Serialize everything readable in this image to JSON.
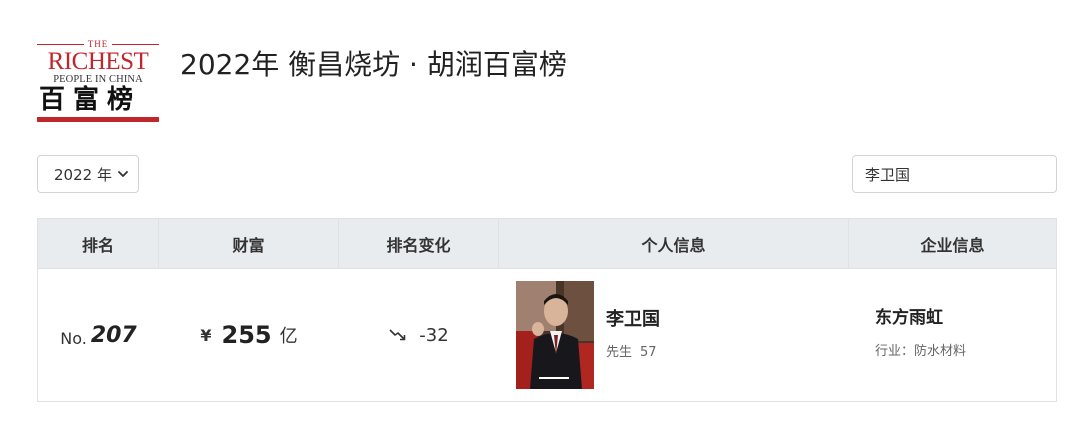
{
  "logo": {
    "the": "THE",
    "richest": "RICHEST",
    "people": "PEOPLE IN CHINA",
    "cn": "百富榜",
    "brand_color": "#c0272d"
  },
  "page": {
    "title": "2022年 衡昌烧坊 · 胡润百富榜"
  },
  "filters": {
    "year_selected": "2022 年",
    "search_value": "李卫国"
  },
  "table": {
    "headers": [
      "排名",
      "财富",
      "排名变化",
      "个人信息",
      "企业信息"
    ],
    "rows": [
      {
        "rank_prefix": "No.",
        "rank": "207",
        "currency": "¥",
        "wealth": "255",
        "wealth_unit": "亿",
        "change_icon": "trend-down-icon",
        "change": "-32",
        "photo": "person-photo",
        "name": "李卫国",
        "title": "先生",
        "age": "57",
        "company": "东方雨虹",
        "industry": "行业：防水材料"
      }
    ]
  },
  "colors": {
    "header_bg": "#e9ecef",
    "border": "#dee2e6"
  }
}
